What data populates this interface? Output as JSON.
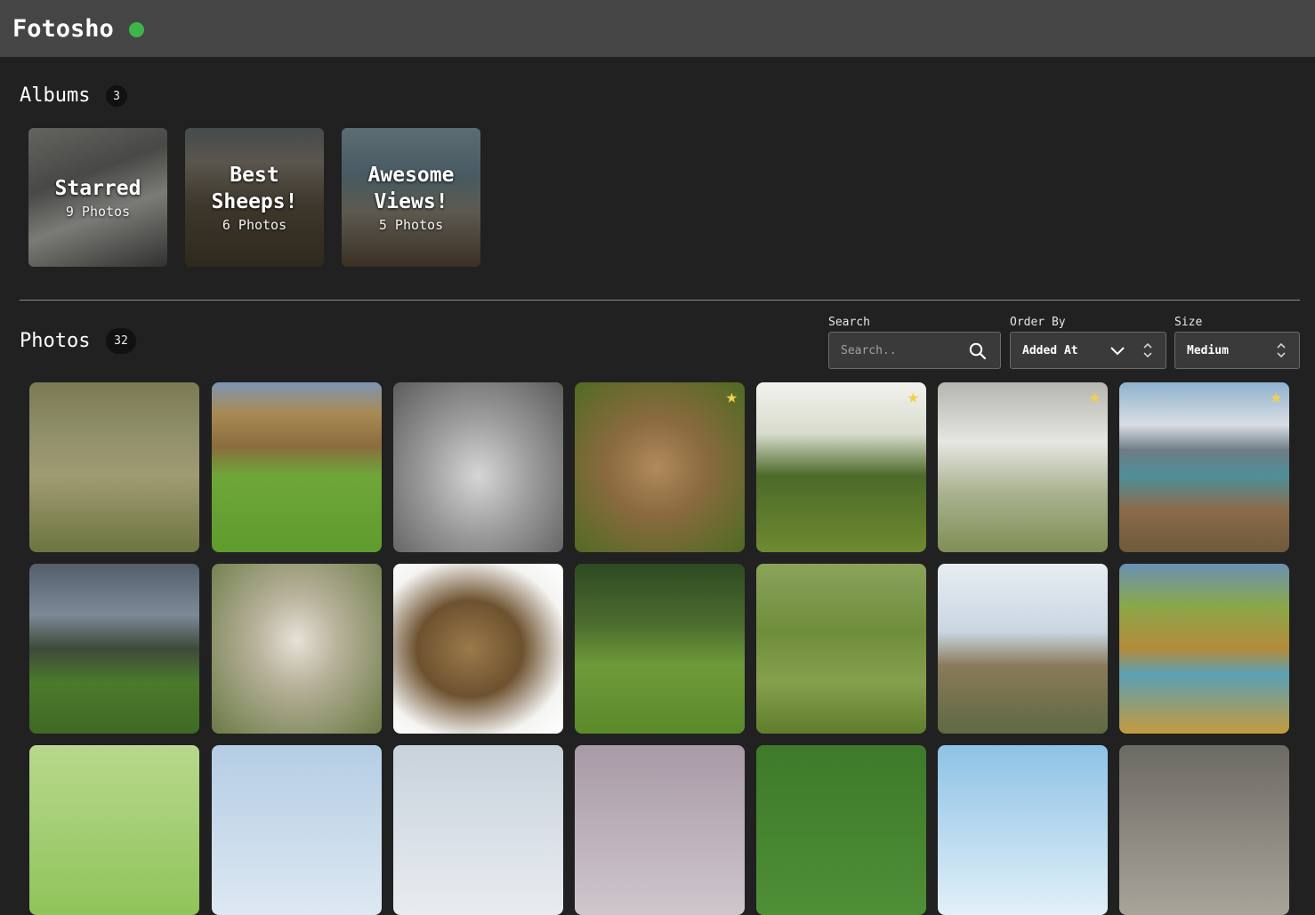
{
  "app": {
    "title": "Fotosho",
    "status_color": "#3cb54a"
  },
  "albums_section": {
    "title": "Albums",
    "count": "3",
    "items": [
      {
        "name": "Starred",
        "count_label": "9 Photos"
      },
      {
        "name": "Best Sheeps!",
        "count_label": "6 Photos"
      },
      {
        "name": "Awesome Views!",
        "count_label": "5 Photos"
      }
    ]
  },
  "photos_section": {
    "title": "Photos",
    "count": "32",
    "search": {
      "label": "Search",
      "placeholder": "Search.."
    },
    "order_by": {
      "label": "Order By",
      "value": "Added At"
    },
    "size": {
      "label": "Size",
      "value": "Medium"
    },
    "photos": [
      {
        "subject": "two lambs lying in grass under tree",
        "starred": false
      },
      {
        "subject": "flock grazing in green valley",
        "starred": false
      },
      {
        "subject": "black and white sheep face",
        "starred": false
      },
      {
        "subject": "woolly brown sheep face",
        "starred": true
      },
      {
        "subject": "sheep grazing with tree backdrop",
        "starred": true
      },
      {
        "subject": "white lamb in soft light",
        "starred": true
      },
      {
        "subject": "lamb lying by snowy mountains and lake",
        "starred": true
      },
      {
        "subject": "sheep on hillside with stormy sky",
        "starred": false
      },
      {
        "subject": "white sheep standing on grass",
        "starred": false
      },
      {
        "subject": "ram with curled horns",
        "starred": false
      },
      {
        "subject": "sheep in grassy field with trees",
        "starred": false
      },
      {
        "subject": "lamb walking in green field",
        "starred": false
      },
      {
        "subject": "row of sheep near wind turbine",
        "starred": false
      },
      {
        "subject": "sheep on golden hillside by lake",
        "starred": false
      },
      {
        "subject": "lamb in bright green field",
        "starred": false
      },
      {
        "subject": "sky over pasture",
        "starred": false
      },
      {
        "subject": "cloudy sky",
        "starred": false
      },
      {
        "subject": "misty hills",
        "starred": false
      },
      {
        "subject": "green grass",
        "starred": false
      },
      {
        "subject": "blue sky with clouds",
        "starred": false
      },
      {
        "subject": "sheep in pen",
        "starred": false
      }
    ]
  },
  "colors": {
    "background": "#212121",
    "header": "#454545",
    "star": "#f5cf48"
  }
}
